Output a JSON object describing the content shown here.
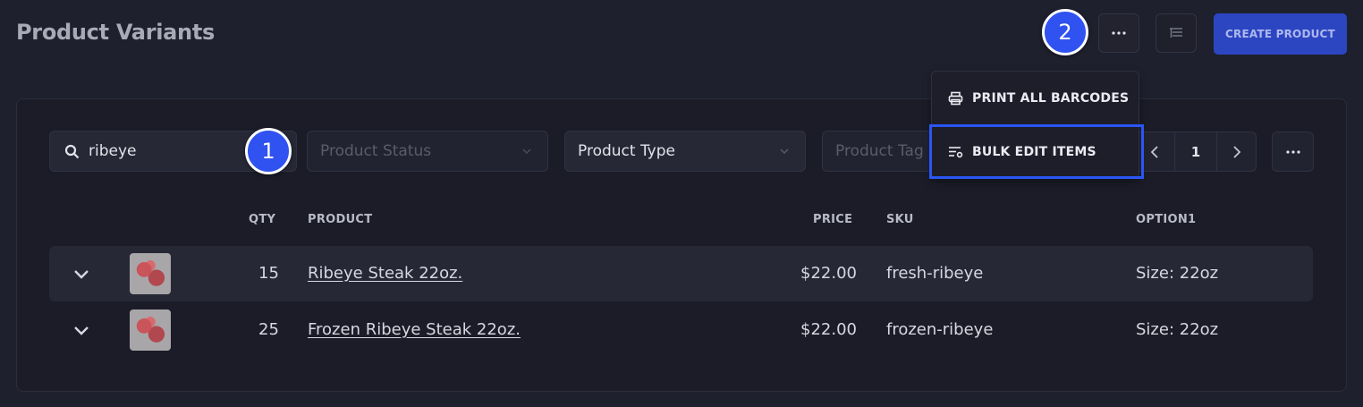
{
  "header": {
    "title": "Product Variants",
    "more_icon": "ellipsis-icon",
    "columns_icon": "columns-icon",
    "create_label": "CREATE PRODUCT"
  },
  "markers": {
    "one": "1",
    "two": "2"
  },
  "filters": {
    "search_value": "ribeye",
    "status_placeholder": "Product Status",
    "type_value": "Product Type",
    "tag_placeholder": "Product Tag"
  },
  "pagination": {
    "current_page": "1"
  },
  "menu": {
    "items": [
      {
        "label": "PRINT ALL BARCODES",
        "icon": "printer-icon"
      },
      {
        "label": "BULK EDIT ITEMS",
        "icon": "bulk-edit-icon"
      }
    ]
  },
  "table": {
    "headers": {
      "qty": "QTY",
      "product": "PRODUCT",
      "price": "PRICE",
      "sku": "SKU",
      "option1": "OPTION1"
    },
    "rows": [
      {
        "qty": "15",
        "product": "Ribeye Steak 22oz.",
        "price": "$22.00",
        "sku": "fresh-ribeye",
        "option1": "Size: 22oz"
      },
      {
        "qty": "25",
        "product": "Frozen Ribeye Steak 22oz.",
        "price": "$22.00",
        "sku": "frozen-ribeye",
        "option1": "Size: 22oz"
      }
    ]
  },
  "colors": {
    "accent": "#2c46c2",
    "highlight": "#2a56f5",
    "marker": "#2f52f0",
    "background": "#1f202e"
  }
}
